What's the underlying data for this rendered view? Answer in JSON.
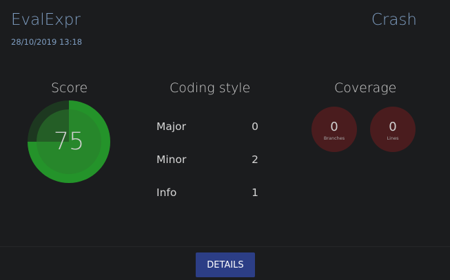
{
  "header": {
    "title": "EvalExpr",
    "date": "28/10/2019 13:18",
    "status": "Crash"
  },
  "score": {
    "title": "Score",
    "value": "75",
    "percent": 75,
    "color_fill": "#24932a",
    "color_track": "#1d3820"
  },
  "coding_style": {
    "title": "Coding style",
    "rows": [
      {
        "label": "Major",
        "value": "0"
      },
      {
        "label": "Minor",
        "value": "2"
      },
      {
        "label": "Info",
        "value": "1"
      }
    ]
  },
  "coverage": {
    "title": "Coverage",
    "items": [
      {
        "value": "0",
        "label": "Branches"
      },
      {
        "value": "0",
        "label": "Lines"
      }
    ],
    "color": "#4a1c1e"
  },
  "footer": {
    "details_label": "DETAILS",
    "button_color": "#2c3e86"
  }
}
